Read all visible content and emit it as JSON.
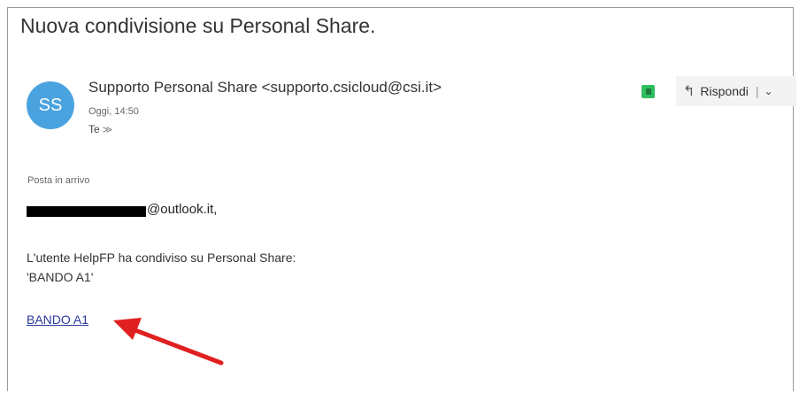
{
  "email": {
    "subject": "Nuova condivisione su Personal Share.",
    "avatar_initials": "SS",
    "sender": "Supporto Personal Share <supporto.csicloud@csi.it>",
    "date": "Oggi, 14:50",
    "to_label": "Te",
    "folder": "Posta in arrivo",
    "address_suffix": "@outlook.it,",
    "body_line1": "L'utente HelpFP ha condiviso su Personal Share:",
    "body_line2": "'BANDO A1'",
    "link_text": "BANDO A1"
  },
  "toolbar": {
    "reply_label": "Rispondi",
    "reply_icon": "reply-arrow-icon",
    "more_icon": "chevron-down-icon",
    "addon_icon": "evernote-icon"
  },
  "colors": {
    "avatar": "#4aa3df",
    "link": "#2b3a9b",
    "annotation_arrow": "#e02020",
    "addon": "#2dbe60"
  }
}
